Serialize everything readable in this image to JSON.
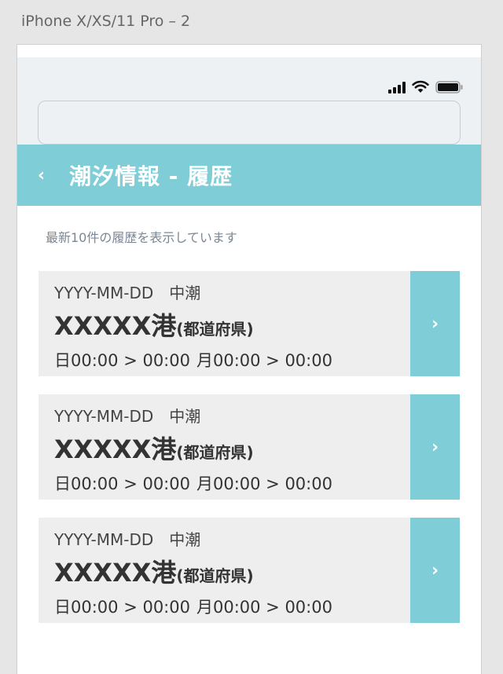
{
  "artboard": {
    "label": "iPhone X/XS/11 Pro – 2"
  },
  "header": {
    "back_icon": "chevron-left-icon",
    "title": "潮汐情報 - 履歴"
  },
  "notice": "最新10件の履歴を表示しています",
  "history": [
    {
      "date": "YYYY-MM-DD",
      "tide": "中潮",
      "port": "XXXXX港",
      "prefecture": "(都道府県)",
      "time_sun": "日00:00 > 00:00",
      "time_moon": "月00:00 > 00:00"
    },
    {
      "date": "YYYY-MM-DD",
      "tide": "中潮",
      "port": "XXXXX港",
      "prefecture": "(都道府県)",
      "time_sun": "日00:00 > 00:00",
      "time_moon": "月00:00 > 00:00"
    },
    {
      "date": "YYYY-MM-DD",
      "tide": "中潮",
      "port": "XXXXX港",
      "prefecture": "(都道府県)",
      "time_sun": "日00:00 > 00:00",
      "time_moon": "月00:00 > 00:00"
    }
  ],
  "arrow_glyph": "›",
  "back_glyph": "‹",
  "colors": {
    "accent": "#7fcdd7",
    "card_bg": "#eeeeee",
    "status_bg": "#eef1f4"
  }
}
